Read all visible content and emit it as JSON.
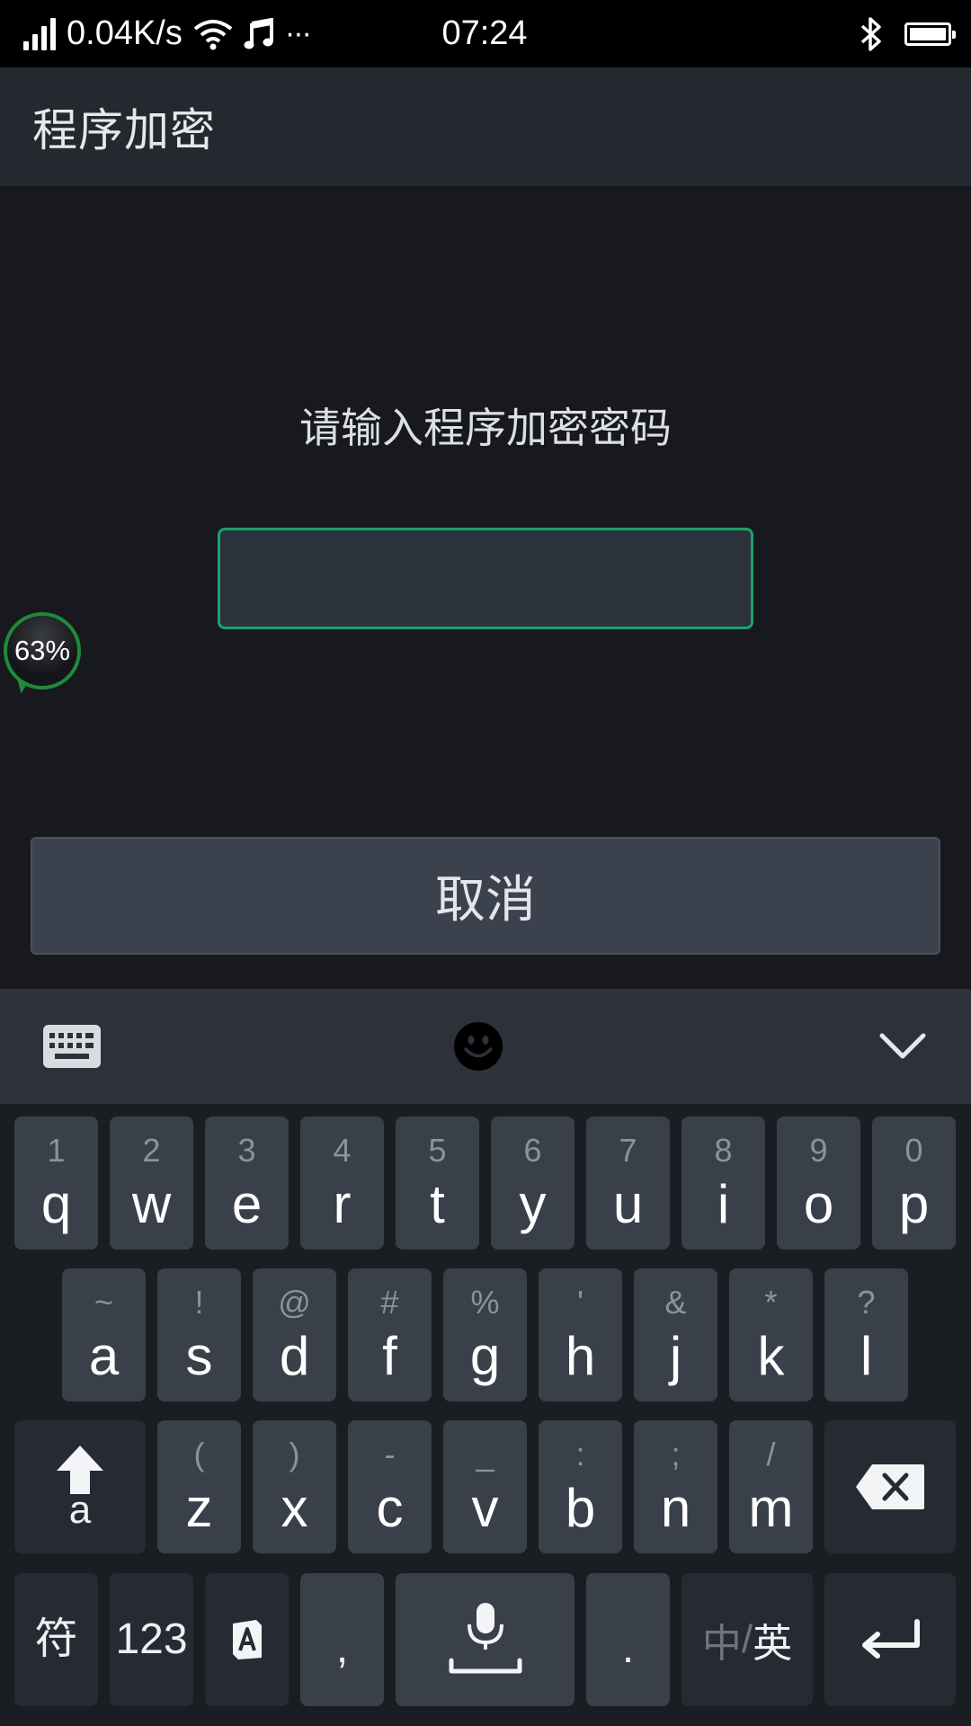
{
  "status_bar": {
    "net_speed": "0.04K/s",
    "time": "07:24",
    "more": "···",
    "icons": [
      "signal-icon",
      "wifi-icon",
      "music-icon",
      "bluetooth-icon",
      "battery-icon"
    ]
  },
  "app_bar": {
    "title": "程序加密"
  },
  "main": {
    "prompt": "请输入程序加密密码",
    "password_value": "",
    "cancel_label": "取消"
  },
  "float_ball": {
    "percent": "63%"
  },
  "keyboard": {
    "toolbar_icons": [
      "keyboard-icon",
      "emoji-icon",
      "chevron-down-icon"
    ],
    "row1": [
      {
        "hint": "1",
        "key": "q"
      },
      {
        "hint": "2",
        "key": "w"
      },
      {
        "hint": "3",
        "key": "e"
      },
      {
        "hint": "4",
        "key": "r"
      },
      {
        "hint": "5",
        "key": "t"
      },
      {
        "hint": "6",
        "key": "y"
      },
      {
        "hint": "7",
        "key": "u"
      },
      {
        "hint": "8",
        "key": "i"
      },
      {
        "hint": "9",
        "key": "o"
      },
      {
        "hint": "0",
        "key": "p"
      }
    ],
    "row2": [
      {
        "hint": "~",
        "key": "a"
      },
      {
        "hint": "!",
        "key": "s"
      },
      {
        "hint": "@",
        "key": "d"
      },
      {
        "hint": "#",
        "key": "f"
      },
      {
        "hint": "%",
        "key": "g"
      },
      {
        "hint": "'",
        "key": "h"
      },
      {
        "hint": "&",
        "key": "j"
      },
      {
        "hint": "*",
        "key": "k"
      },
      {
        "hint": "?",
        "key": "l"
      }
    ],
    "row3": [
      {
        "hint": "(",
        "key": "z"
      },
      {
        "hint": ")",
        "key": "x"
      },
      {
        "hint": "-",
        "key": "c"
      },
      {
        "hint": "_",
        "key": "v"
      },
      {
        "hint": ":",
        "key": "b"
      },
      {
        "hint": ";",
        "key": "n"
      },
      {
        "hint": "/",
        "key": "m"
      }
    ],
    "shift_label": "a",
    "symbols_label": "符",
    "numbers_label": "123",
    "comma_label": ",",
    "period_label": ".",
    "lang_cn": "中",
    "lang_sep": "/",
    "lang_en": "英"
  }
}
